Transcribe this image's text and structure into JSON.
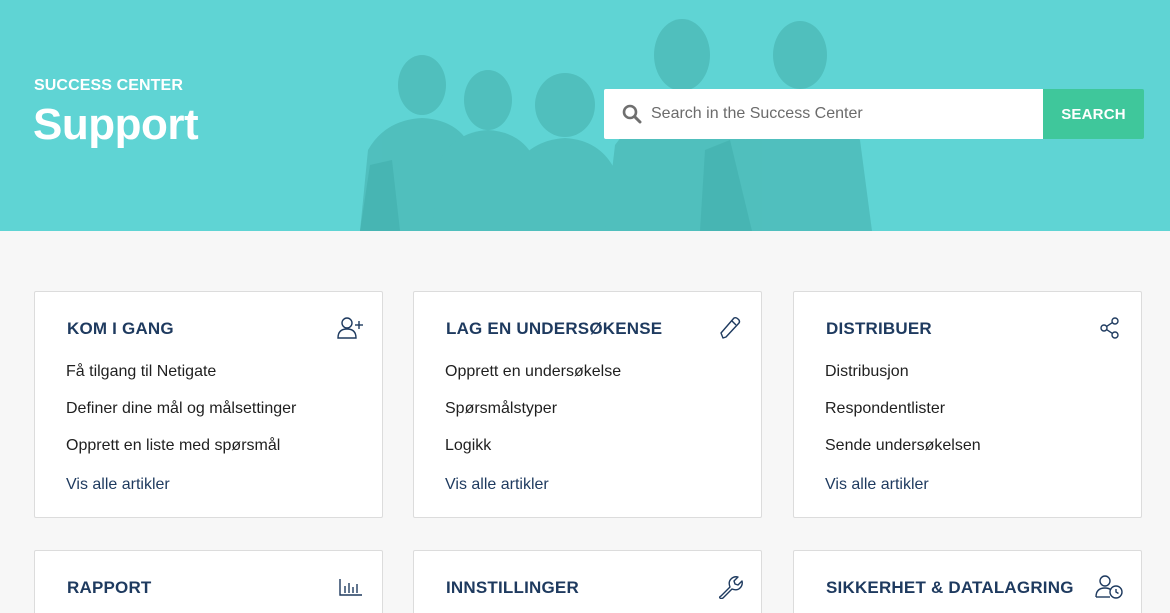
{
  "hero": {
    "eyebrow": "SUCCESS CENTER",
    "title": "Support",
    "background_color": "#5fd4d4"
  },
  "search": {
    "placeholder": "Search in the Success Center",
    "button_label": "SEARCH",
    "icon": "search-icon",
    "button_color": "#3fc79b"
  },
  "cards": [
    {
      "title": "KOM I GANG",
      "icon": "user-plus-icon",
      "links": [
        "Få tilgang til Netigate",
        "Definer dine mål og målsettinger",
        "Opprett en liste med spørsmål"
      ],
      "more": "Vis alle artikler"
    },
    {
      "title": "LAG EN UNDERSØKENSE",
      "icon": "pencil-icon",
      "links": [
        "Opprett en undersøkelse",
        "Spørsmålstyper",
        "Logikk"
      ],
      "more": "Vis alle artikler"
    },
    {
      "title": "DISTRIBUER",
      "icon": "share-icon",
      "links": [
        "Distribusjon",
        "Respondentlister",
        "Sende undersøkelsen"
      ],
      "more": "Vis alle artikler"
    },
    {
      "title": "RAPPORT",
      "icon": "bar-chart-icon"
    },
    {
      "title": "INNSTILLINGER",
      "icon": "wrench-icon"
    },
    {
      "title": "SIKKERHET & DATALAGRING",
      "icon": "user-clock-icon"
    }
  ],
  "colors": {
    "title": "#1e3a5f",
    "page_background": "#f7f7f7"
  }
}
